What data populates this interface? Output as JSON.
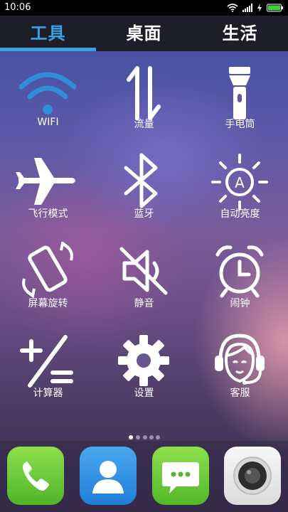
{
  "status": {
    "time": "10:06"
  },
  "tabs": [
    {
      "label": "工具",
      "active": true
    },
    {
      "label": "桌面",
      "active": false
    },
    {
      "label": "生活",
      "active": false
    }
  ],
  "tiles": [
    {
      "label": "WIFI",
      "icon": "wifi-icon"
    },
    {
      "label": "流量",
      "icon": "data-arrows-icon"
    },
    {
      "label": "手电筒",
      "icon": "flashlight-icon"
    },
    {
      "label": "飞行模式",
      "icon": "airplane-icon"
    },
    {
      "label": "蓝牙",
      "icon": "bluetooth-icon"
    },
    {
      "label": "自动亮度",
      "icon": "auto-brightness-icon"
    },
    {
      "label": "屏幕旋转",
      "icon": "screen-rotation-icon"
    },
    {
      "label": "静音",
      "icon": "mute-icon"
    },
    {
      "label": "闹钟",
      "icon": "alarm-clock-icon"
    },
    {
      "label": "计算器",
      "icon": "calculator-icon"
    },
    {
      "label": "设置",
      "icon": "settings-gear-icon"
    },
    {
      "label": "客服",
      "icon": "customer-service-icon"
    }
  ],
  "pager": {
    "pages": 5,
    "current": 1
  },
  "dock": [
    {
      "icon": "phone-icon"
    },
    {
      "icon": "contacts-icon"
    },
    {
      "icon": "messages-icon"
    },
    {
      "icon": "camera-icon"
    }
  ],
  "colors": {
    "accent": "#3aa1e6",
    "wifi_blue": "#2f8fd6"
  }
}
